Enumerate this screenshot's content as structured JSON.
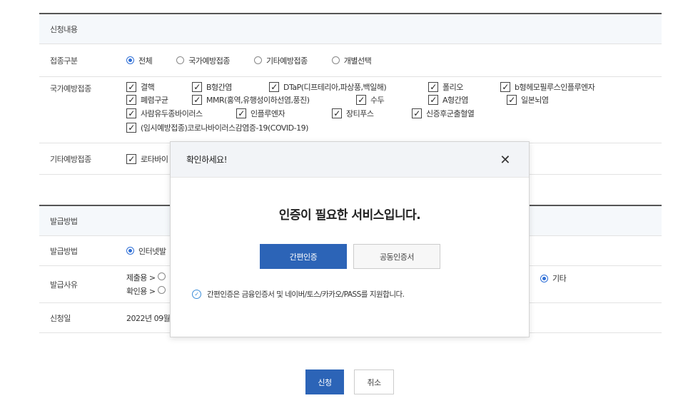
{
  "application": {
    "section_title": "신청내용",
    "vaccination_type": {
      "label": "접종구분",
      "options": [
        "전체",
        "국가예방접종",
        "기타예방접종",
        "개별선택"
      ],
      "selected": "전체"
    },
    "national_vaccines": {
      "label": "국가예방접종",
      "items": [
        "결핵",
        "B형간염",
        "DTaP(디프테리아,파상풍,백일해)",
        "폴리오",
        "b형헤모필루스인플루엔자",
        "폐렴구균",
        "MMR(홍역,유행성이하선염,풍진)",
        "수두",
        "A형간염",
        "일본뇌염",
        "사람유두종바이러스",
        "인플루엔자",
        "장티푸스",
        "신증후군출혈열",
        "(임시예방접종)코로나바이러스감염증-19(COVID-19)"
      ]
    },
    "other_vaccines": {
      "label": "기타예방접종",
      "items": [
        "로타바이"
      ]
    }
  },
  "issuance": {
    "section_title": "발급방법",
    "method": {
      "label": "발급방법",
      "selected_option": "인터넷발"
    },
    "reason": {
      "label": "발급사유",
      "line1": "제출용 >",
      "line2": "확인용 >",
      "other_option": "기타"
    },
    "date": {
      "label": "신청일",
      "value": "2022년 09월"
    }
  },
  "actions": {
    "submit": "신청",
    "cancel": "취소"
  },
  "modal": {
    "title": "확인하세요!",
    "close_symbol": "✕",
    "message": "인증이 필요한 서비스입니다.",
    "simple_auth": "간편인증",
    "joint_cert": "공동인증서",
    "note": "간편인증은 금융인증서 및 네이버/토스/카카오/PASS를 지원합니다."
  },
  "colors": {
    "primary": "#2c64b7",
    "radio_active": "#2f6fd6",
    "header_bg": "#f5f8fb"
  }
}
